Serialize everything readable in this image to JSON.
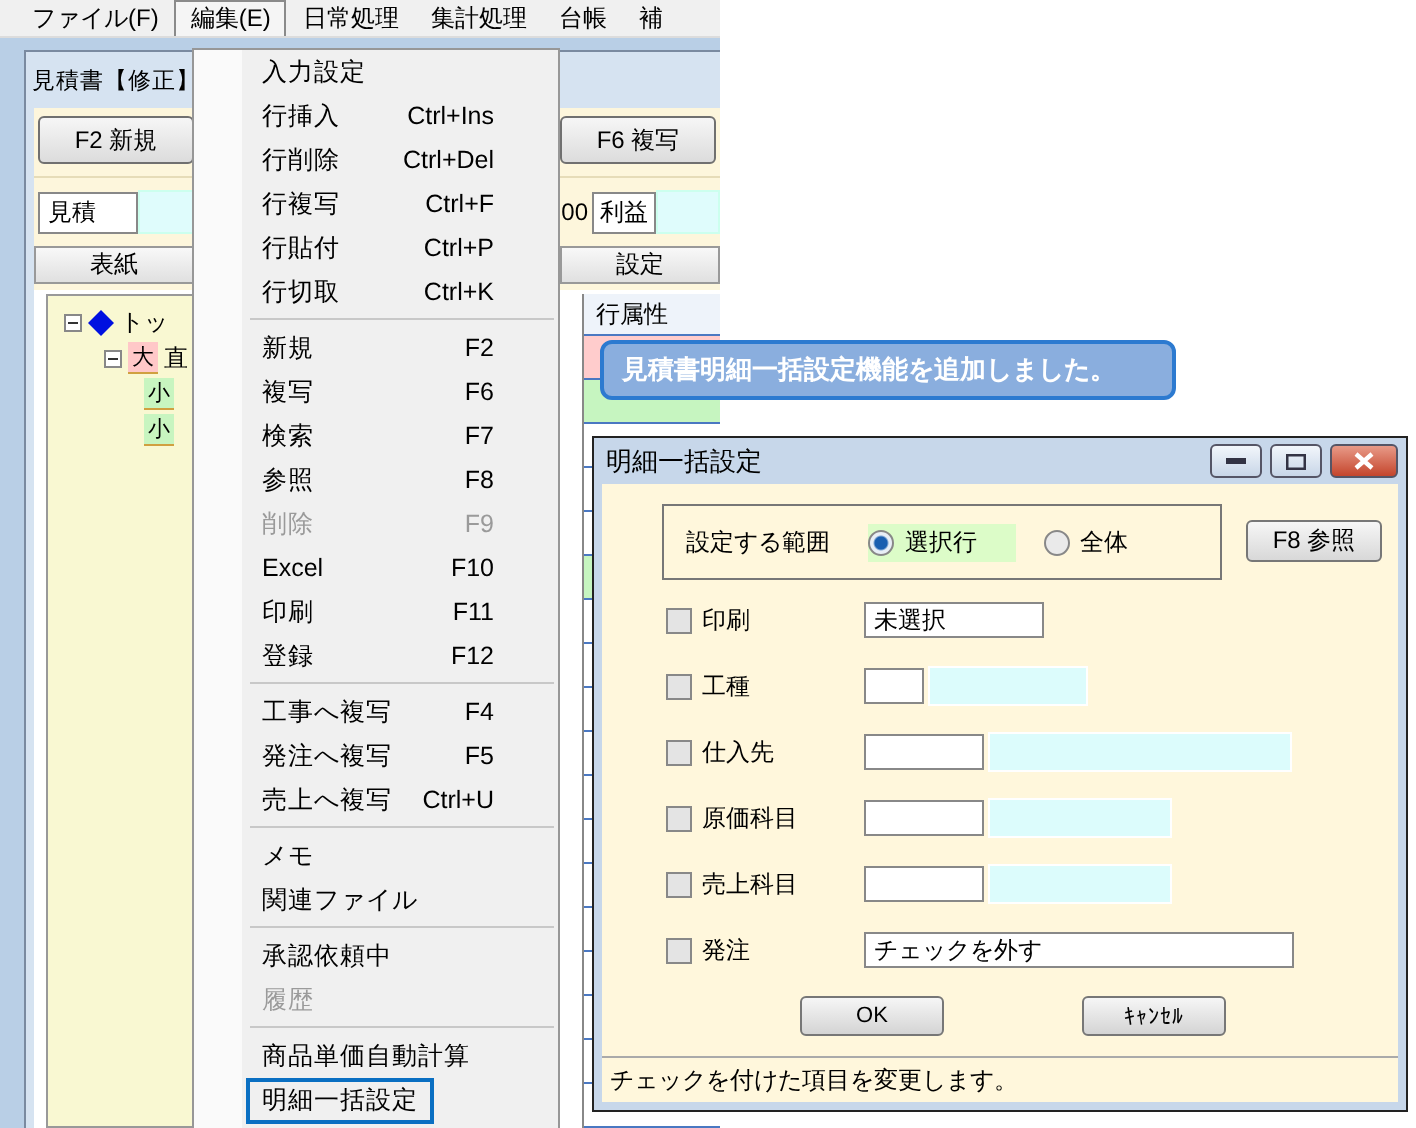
{
  "menubar": [
    {
      "label": "ファイル(F)",
      "selected": false
    },
    {
      "label": "編集(E)",
      "selected": true
    },
    {
      "label": "日常処理",
      "selected": false
    },
    {
      "label": "集計処理",
      "selected": false
    },
    {
      "label": "台帳",
      "selected": false
    },
    {
      "label": "補",
      "selected": false
    }
  ],
  "window": {
    "title": "見積書【修正】",
    "toolbar": [
      "F2 新規",
      "F6 複写"
    ],
    "summary": {
      "label_1": "見積",
      "value": "00",
      "label_2": "利益"
    },
    "tabs": [
      "表紙",
      "設定"
    ],
    "tree": [
      {
        "kind": "top",
        "label": "トッ",
        "expanded": true,
        "children": [
          {
            "kind": "large",
            "tag": "大",
            "label": "直",
            "expanded": true,
            "children": [
              {
                "kind": "small",
                "tag": "小"
              },
              {
                "kind": "small",
                "tag": "小"
              }
            ]
          }
        ]
      }
    ],
    "grid": {
      "columns": [
        "行属性"
      ],
      "rows": [
        {
          "color": "#ffcccc"
        },
        {
          "color": "#c6f5c0"
        },
        {
          "color": "#ffffff"
        },
        {
          "color": "#ffffff"
        },
        {
          "color": "#ffffff"
        },
        {
          "color": "#c6f5c0"
        },
        {
          "color": "#ffffff"
        },
        {
          "color": "#ffffff"
        },
        {
          "color": "#ffffff"
        },
        {
          "color": "#ffffff"
        },
        {
          "color": "#ffffff"
        },
        {
          "color": "#ffffff"
        },
        {
          "color": "#ffffff"
        },
        {
          "color": "#ffffff"
        },
        {
          "color": "#ffffff"
        },
        {
          "color": "#ffffff"
        },
        {
          "color": "#ffffff"
        },
        {
          "color": "#ffffff"
        }
      ]
    }
  },
  "edit_menu": [
    {
      "kind": "item",
      "label": "入力設定",
      "disabled": false,
      "selected": false
    },
    {
      "kind": "item",
      "label": "行挿入",
      "shortcut": "Ctrl+Ins",
      "disabled": false,
      "selected": false
    },
    {
      "kind": "item",
      "label": "行削除",
      "shortcut": "Ctrl+Del",
      "disabled": false,
      "selected": false
    },
    {
      "kind": "item",
      "label": "行複写",
      "shortcut": "Ctrl+F",
      "disabled": false,
      "selected": false
    },
    {
      "kind": "item",
      "label": "行貼付",
      "shortcut": "Ctrl+P",
      "disabled": false,
      "selected": false
    },
    {
      "kind": "item",
      "label": "行切取",
      "shortcut": "Ctrl+K",
      "disabled": false,
      "selected": false
    },
    {
      "kind": "separator"
    },
    {
      "kind": "item",
      "label": "新規",
      "shortcut": "F2",
      "disabled": false,
      "selected": false
    },
    {
      "kind": "item",
      "label": "複写",
      "shortcut": "F6",
      "disabled": false,
      "selected": false
    },
    {
      "kind": "item",
      "label": "検索",
      "shortcut": "F7",
      "disabled": false,
      "selected": false
    },
    {
      "kind": "item",
      "label": "参照",
      "shortcut": "F8",
      "disabled": false,
      "selected": false
    },
    {
      "kind": "item",
      "label": "削除",
      "shortcut": "F9",
      "disabled": true,
      "selected": false
    },
    {
      "kind": "item",
      "label": "Excel",
      "shortcut": "F10",
      "disabled": false,
      "selected": false
    },
    {
      "kind": "item",
      "label": "印刷",
      "shortcut": "F11",
      "disabled": false,
      "selected": false
    },
    {
      "kind": "item",
      "label": "登録",
      "shortcut": "F12",
      "disabled": false,
      "selected": false
    },
    {
      "kind": "separator"
    },
    {
      "kind": "item",
      "label": "工事へ複写",
      "shortcut": "F4",
      "disabled": false,
      "selected": false
    },
    {
      "kind": "item",
      "label": "発注へ複写",
      "shortcut": "F5",
      "disabled": false,
      "selected": false
    },
    {
      "kind": "item",
      "label": "売上へ複写",
      "shortcut": "Ctrl+U",
      "disabled": false,
      "selected": false
    },
    {
      "kind": "separator"
    },
    {
      "kind": "item",
      "label": "メモ",
      "disabled": false,
      "selected": false
    },
    {
      "kind": "item",
      "label": "関連ファイル",
      "disabled": false,
      "selected": false
    },
    {
      "kind": "separator"
    },
    {
      "kind": "item",
      "label": "承認依頼中",
      "disabled": false,
      "selected": false
    },
    {
      "kind": "item",
      "label": "履歴",
      "disabled": true,
      "selected": false
    },
    {
      "kind": "separator"
    },
    {
      "kind": "item",
      "label": "商品単価自動計算",
      "disabled": false,
      "selected": false
    },
    {
      "kind": "item",
      "label": "明細一括設定",
      "disabled": false,
      "selected": true
    }
  ],
  "callout": "見積書明細一括設定機能を追加しました。",
  "dialog": {
    "title": "明細一括設定",
    "range": {
      "label": "設定する範囲",
      "options": [
        {
          "label": "選択行",
          "selected": true
        },
        {
          "label": "全体",
          "selected": false
        }
      ]
    },
    "reference_button": "F8 参照",
    "rows": [
      {
        "kind": "text",
        "label": "印刷",
        "checked": false,
        "value": "未選択"
      },
      {
        "kind": "code",
        "label": "工種",
        "checked": false
      },
      {
        "kind": "code",
        "label": "仕入先",
        "checked": false
      },
      {
        "kind": "code",
        "label": "原価科目",
        "checked": false
      },
      {
        "kind": "code",
        "label": "売上科目",
        "checked": false
      },
      {
        "kind": "text",
        "label": "発注",
        "checked": false,
        "value": "チェックを外す"
      }
    ],
    "buttons": [
      "OK",
      "ｷｬﾝｾﾙ"
    ],
    "status": "チェックを付けた項目を変更します。"
  }
}
